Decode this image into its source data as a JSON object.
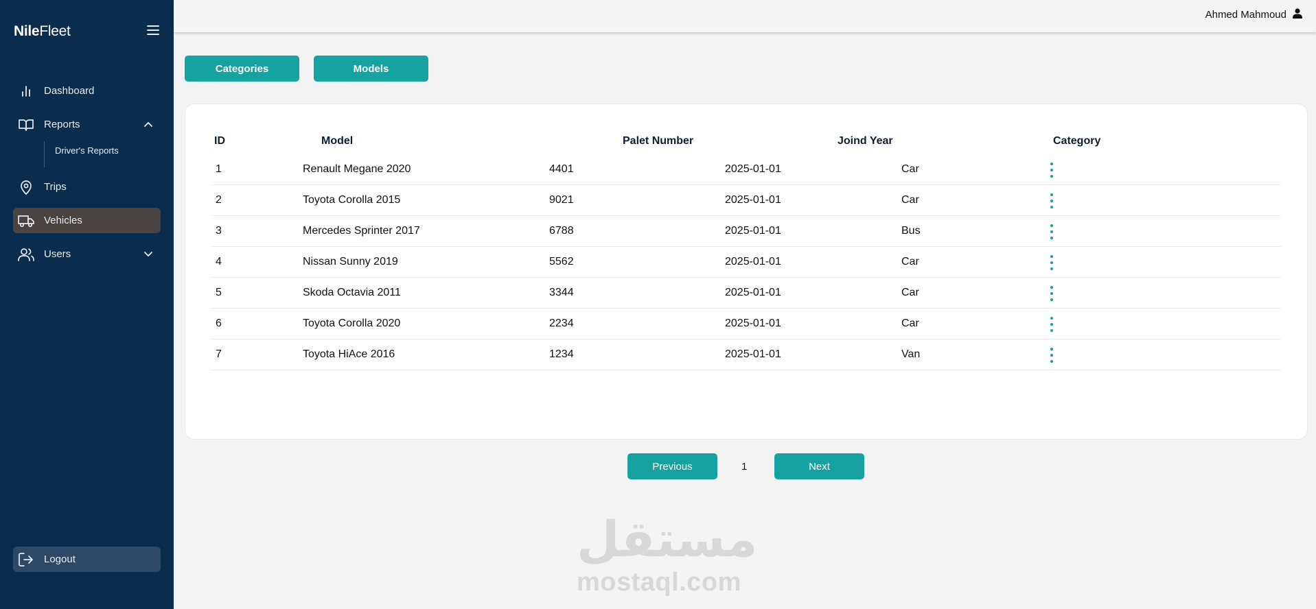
{
  "brand": {
    "bold": "Nile",
    "regular": "Fleet"
  },
  "sidebar": {
    "items": [
      {
        "label": "Dashboard",
        "icon": "bar-chart-icon"
      },
      {
        "label": "Reports",
        "icon": "book-icon",
        "expanded": true
      },
      {
        "label": "Trips",
        "icon": "map-pin-icon"
      },
      {
        "label": "Vehicles",
        "icon": "truck-icon",
        "active": true
      },
      {
        "label": "Users",
        "icon": "users-icon",
        "expanded": false
      }
    ],
    "subitems": [
      {
        "label": "Driver's Reports"
      }
    ],
    "logout_label": "Logout"
  },
  "topbar": {
    "user_name": "Ahmed Mahmoud"
  },
  "tabs": {
    "categories": "Categories",
    "models": "Models"
  },
  "table": {
    "headers": {
      "id": "ID",
      "model": "Model",
      "plate": "Palet Number",
      "year": "Joind Year",
      "category": "Category"
    },
    "rows": [
      {
        "id": "1",
        "model": "Renault Megane 2020",
        "plate": "4401",
        "year": "2025-01-01",
        "category": "Car"
      },
      {
        "id": "2",
        "model": "Toyota Corolla 2015",
        "plate": "9021",
        "year": "2025-01-01",
        "category": "Car"
      },
      {
        "id": "3",
        "model": "Mercedes Sprinter 2017",
        "plate": "6788",
        "year": "2025-01-01",
        "category": "Bus"
      },
      {
        "id": "4",
        "model": "Nissan Sunny 2019",
        "plate": "5562",
        "year": "2025-01-01",
        "category": "Car"
      },
      {
        "id": "5",
        "model": "Skoda Octavia 2011",
        "plate": "3344",
        "year": "2025-01-01",
        "category": "Car"
      },
      {
        "id": "6",
        "model": "Toyota Corolla 2020",
        "plate": "2234",
        "year": "2025-01-01",
        "category": "Car"
      },
      {
        "id": "7",
        "model": "Toyota HiAce 2016",
        "plate": "1234",
        "year": "2025-01-01",
        "category": "Van"
      }
    ]
  },
  "pagination": {
    "previous": "Previous",
    "page": "1",
    "next": "Next"
  },
  "watermark": {
    "arabic": "مستقل",
    "latin": "mostaql.com"
  },
  "colors": {
    "sidebar": "#0b2d4d",
    "accent": "#16a2a0",
    "active_item": "#4b4340"
  }
}
